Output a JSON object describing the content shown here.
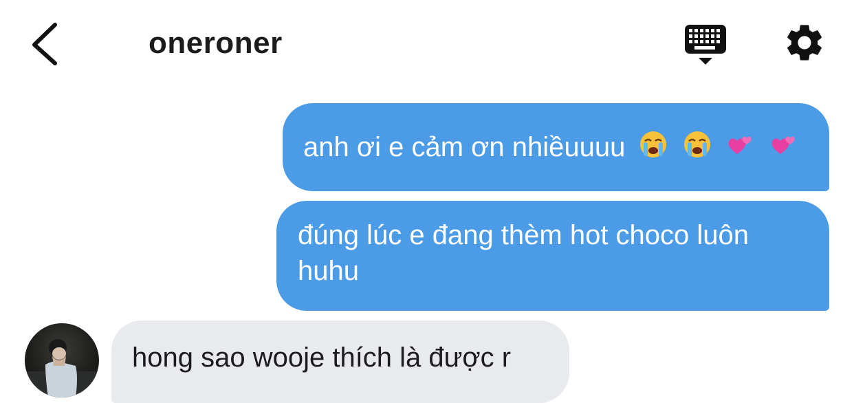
{
  "header": {
    "title": "oneroner",
    "back_icon": "chevron-left-icon",
    "keyboard_icon": "keyboard-icon",
    "settings_icon": "gear-icon"
  },
  "messages": [
    {
      "direction": "outgoing",
      "text": "anh ơi e cảm ơn nhiềuuuu",
      "emojis": [
        "loudly-crying-face",
        "loudly-crying-face",
        "two-hearts",
        "two-hearts"
      ]
    },
    {
      "direction": "outgoing",
      "text": "đúng lúc e đang thèm hot choco luôn huhu"
    },
    {
      "direction": "incoming",
      "text": "hong sao wooje thích là được r"
    }
  ],
  "colors": {
    "outgoing_bubble": "#4c9be6",
    "incoming_bubble": "#e9eaed",
    "text_dark": "#1c1c1e"
  }
}
